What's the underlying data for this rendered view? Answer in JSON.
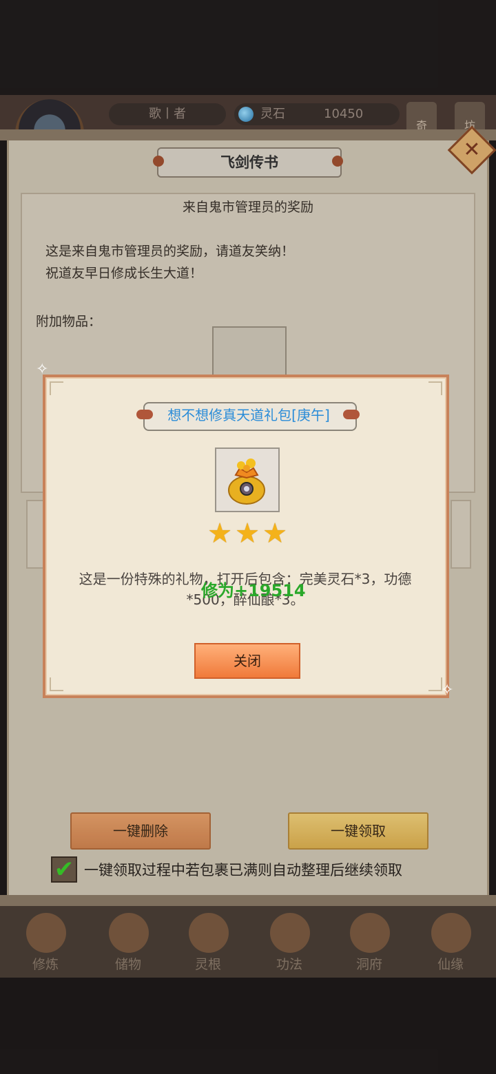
{
  "hud": {
    "player_name": "歌丨者",
    "currency_label": "灵石",
    "currency_value": "10450",
    "side_tabs": [
      "奇",
      "坊"
    ]
  },
  "mail": {
    "window_title": "飞剑传书",
    "subject": "来自鬼市管理员的奖励",
    "body_lines": [
      "这是来自鬼市管理员的奖励，请道友笑纳！",
      "祝道友早日修成长生大道！"
    ],
    "attachments_label": "附加物品："
  },
  "actions": {
    "delete_all": "一键删除",
    "claim_all": "一键领取",
    "auto_sort_label": "一键领取过程中若包裹已满则自动整理后继续领取",
    "auto_sort_checked": true
  },
  "popup": {
    "title": "想不想修真天道礼包[庚午]",
    "stars": 3,
    "description": "这是一份特殊的礼物，打开后包含：完美灵石*3，功德*500，醉仙酿*3。",
    "floating_text": "修为+19514",
    "close_label": "关闭"
  },
  "nav": [
    "修炼",
    "储物",
    "灵根",
    "功法",
    "洞府",
    "仙缘"
  ],
  "colors": {
    "popup_title": "#2a8cd8",
    "floating_text": "#2aa82a",
    "star": "#f4b21a",
    "popup_border": "#c8825a"
  }
}
